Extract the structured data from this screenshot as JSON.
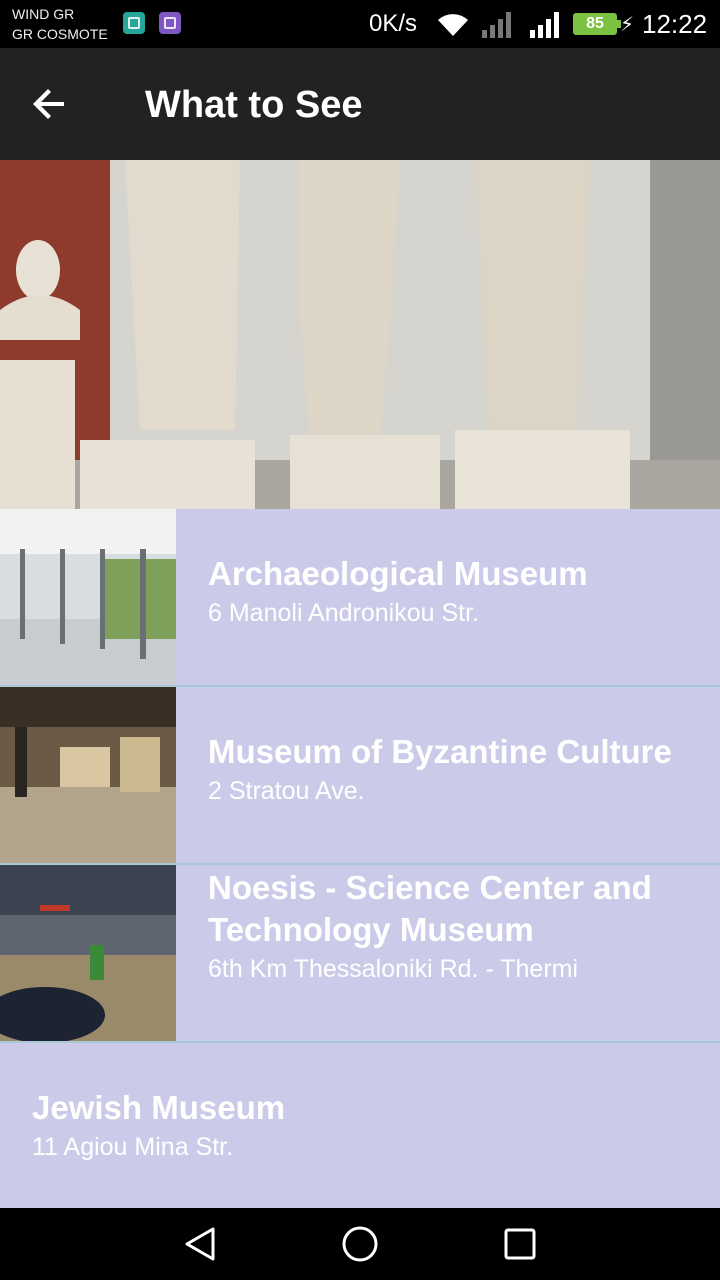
{
  "status_bar": {
    "carrier_1": "WIND GR",
    "carrier_2": "GR COSMOTE",
    "net_speed": "0K/s",
    "battery": "85",
    "time": "12:22"
  },
  "app_bar": {
    "title": "What to See",
    "back_icon": "arrow-left-icon"
  },
  "items": [
    {
      "name": "Archaeological Museum",
      "address": "6 Manoli Andronikou Str."
    },
    {
      "name": "Museum of Byzantine Culture",
      "address": "2 Stratou Ave."
    },
    {
      "name": "Noesis - Science Center and Technology Museum",
      "address": "6th Km Thessaloniki Rd. - Thermi"
    },
    {
      "name": "Jewish Museum",
      "address": "11 Agiou Mina Str."
    }
  ],
  "colors": {
    "app_bar": "#222222",
    "list_background": "#cbcbe9",
    "divider": "#a9c7d4",
    "battery": "#7cc242"
  }
}
